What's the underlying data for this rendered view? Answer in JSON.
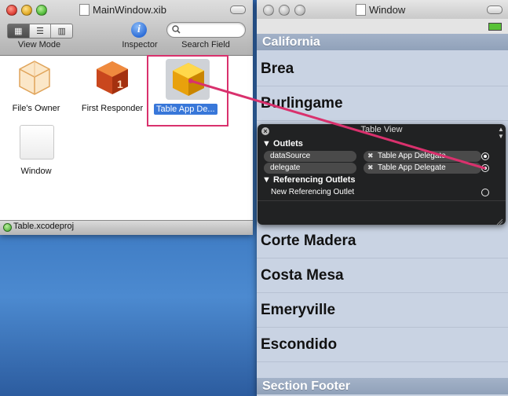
{
  "xib_window": {
    "title": "MainWindow.xib",
    "toolbar": {
      "view_mode_label": "View Mode",
      "inspector_label": "Inspector",
      "search_label": "Search Field"
    },
    "items": [
      {
        "label": "File's Owner"
      },
      {
        "label": "First Responder"
      },
      {
        "label": "Table App De..."
      },
      {
        "label": "Window"
      }
    ],
    "status": "Table.xcodeproj"
  },
  "sim_window": {
    "title": "Window",
    "section_header": "California",
    "rows": [
      "Brea",
      "Burlingame",
      "Corte Madera",
      "Costa Mesa",
      "Emeryville",
      "Escondido"
    ],
    "section_footer": "Section Footer"
  },
  "hud": {
    "title": "Table View",
    "outlets_header": "Outlets",
    "outlets": [
      {
        "name": "dataSource",
        "target": "Table App Delegate"
      },
      {
        "name": "delegate",
        "target": "Table App Delegate"
      }
    ],
    "referencing_header": "Referencing Outlets",
    "new_referencing": "New Referencing Outlet"
  },
  "colors": {
    "connection_line": "#d9316d",
    "selection_blue": "#3877d9",
    "desktop_blue": "#3d7ac2"
  }
}
